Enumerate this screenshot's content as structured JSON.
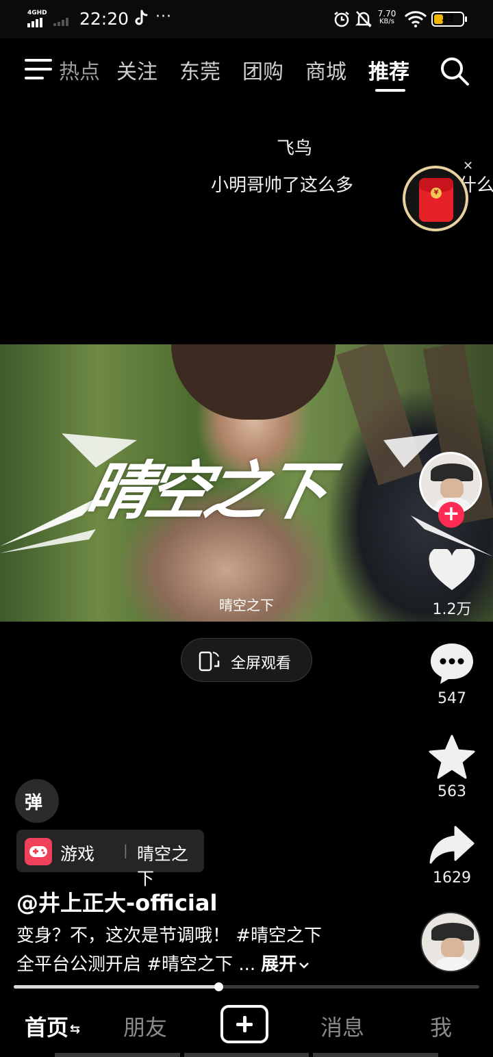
{
  "status_bar": {
    "network": "4GHD",
    "time": "22:20",
    "more": "···",
    "speed_value": "7.70",
    "speed_unit": "KB/s",
    "battery": "33"
  },
  "top_nav": {
    "tabs": [
      "热点",
      "关注",
      "东莞",
      "团购",
      "商城",
      "推荐"
    ],
    "active_tab": "推荐"
  },
  "danmaku": {
    "line1": "飞鸟",
    "line2": "小明哥帅了这么多",
    "line3": "什么"
  },
  "video": {
    "title_overlay": "晴空之下",
    "caption": "晴空之下"
  },
  "fullscreen_label": "全屏观看",
  "rail": {
    "likes": "1.2万",
    "comments": "547",
    "favorites": "563",
    "shares": "1629"
  },
  "danmaku_toggle_label": "弹",
  "game_tag": {
    "category": "游戏",
    "separator": "|",
    "name": "晴空之下"
  },
  "author": "@井上正大-official",
  "description": {
    "line1": "变身？不，这次是节调哦！ #晴空之下",
    "line2": "全平台公测开启 #晴空之下 ...",
    "expand": "展开"
  },
  "progress": 0.44,
  "bottom_nav": {
    "home": "首页",
    "friends": "朋友",
    "messages": "消息",
    "me": "我"
  },
  "colors": {
    "accent": "#fe2c55",
    "battery": "#f2b705",
    "red_packet": "#e6212a",
    "game_icon": "#f1415a"
  }
}
